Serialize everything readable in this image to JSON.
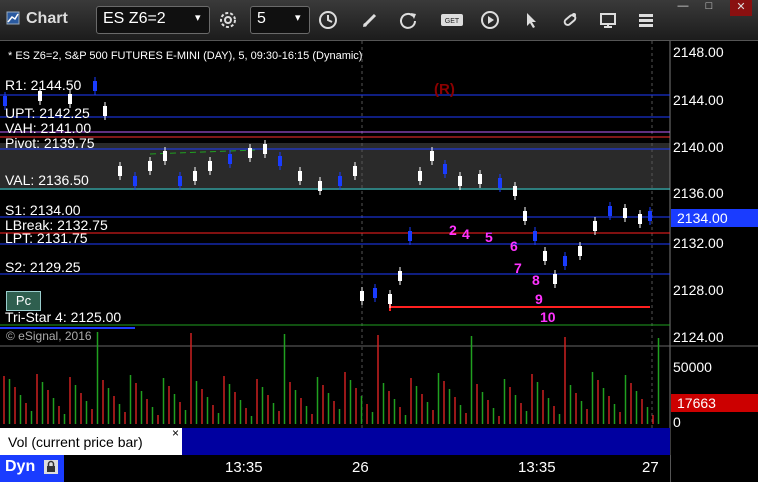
{
  "window": {
    "title": "Chart",
    "min_label": "—",
    "max_label": "□",
    "close_label": "✕"
  },
  "toolbar": {
    "symbol": "ES Z6=2",
    "interval": "5",
    "get_label": "GET"
  },
  "chart": {
    "header": "* ES Z6=2, S&P 500 FUTURES E-MINI (DAY), 5, 09:30-16:15 (Dynamic)",
    "copyright": "© eSignal, 2016",
    "r_marker": "(R)",
    "pc_label": "Pc",
    "price_ticks": [
      "2148.00",
      "2144.00",
      "2140.00",
      "2136.00",
      "2132.00",
      "2128.00",
      "2124.00"
    ],
    "current_price": "2134.00",
    "levels": [
      {
        "label": "R1: 2144.50",
        "color": "#1e3cff"
      },
      {
        "label": "UPT: 2142.25",
        "color": "#1e3cff"
      },
      {
        "label": "VAH: 2141.00",
        "color": "#c060ff"
      },
      {
        "label": "Pivot: 2139.75",
        "color": "#1e3cff"
      },
      {
        "label": "VAL: 2136.50",
        "color": "#30d0d0"
      },
      {
        "label": "S1: 2134.00",
        "color": "#1e3cff"
      },
      {
        "label": "LBreak: 2132.75",
        "color": "#ff2020"
      },
      {
        "label": "LPT: 2131.75",
        "color": "#1e3cff"
      },
      {
        "label": "S2: 2129.25",
        "color": "#1e3cff"
      },
      {
        "label": "Tri-Star 4: 2125.00",
        "color": "#20a020"
      }
    ],
    "counts": [
      "2",
      "4",
      "5",
      "6",
      "7",
      "8",
      "9",
      "10"
    ],
    "vol_ticks": [
      "50000",
      "0"
    ],
    "current_volume": "17663",
    "vol_label": "Vol (current price bar)",
    "vol_close": "×",
    "time_labels": [
      "13:35",
      "26",
      "13:35",
      "27"
    ],
    "footer_label": "Dyn",
    "colors": {
      "up": "#ffffff",
      "down": "#1a3cff",
      "accent": "#cc0000",
      "count": "#ff33ff"
    }
  }
}
